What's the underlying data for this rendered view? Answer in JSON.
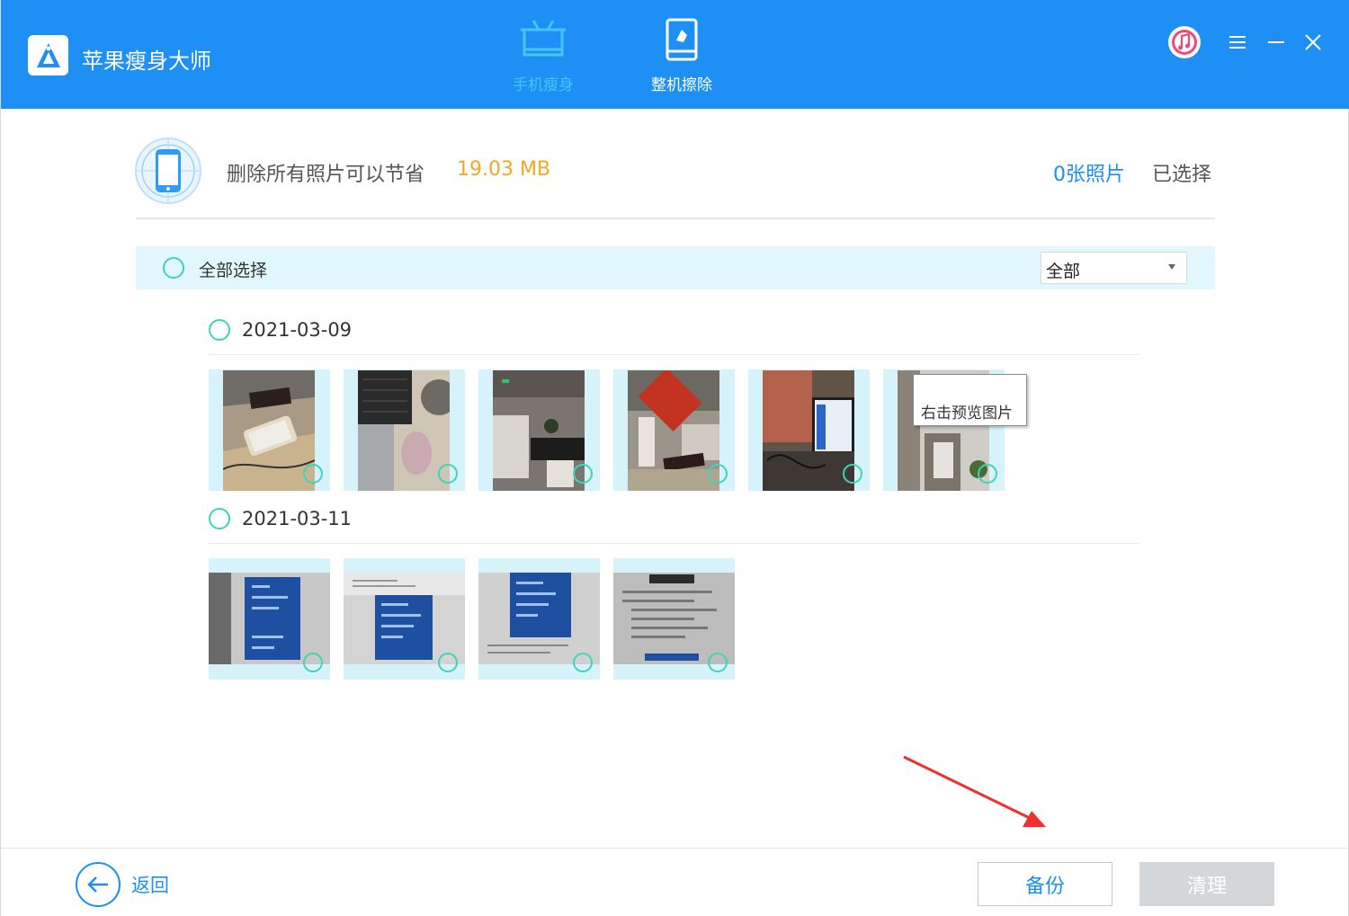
{
  "app": {
    "title": "苹果瘦身大师",
    "accent_color": "#1e90f5",
    "logo_icon": "app-logo-icon"
  },
  "nav": {
    "tabs": [
      {
        "label": "手机瘦身",
        "icon": "broom-tray-icon",
        "active": true
      },
      {
        "label": "整机擦除",
        "icon": "phone-erase-icon",
        "active": false
      }
    ]
  },
  "window_controls": {
    "itunes_icon": "itunes-icon",
    "menu_icon": "menu-icon",
    "minimize_icon": "minimize-icon",
    "close_icon": "close-icon"
  },
  "summary": {
    "text": "删除所有照片可以节省",
    "size": "19.03 MB",
    "size_color": "#f5a623",
    "photo_count": "0张照片",
    "selected_label": "已选择"
  },
  "toolbar": {
    "select_all_label": "全部选择",
    "filter_value": "全部"
  },
  "groups": [
    {
      "date": "2021-03-09",
      "photo_count": 6
    },
    {
      "date": "2021-03-11",
      "photo_count": 4
    }
  ],
  "tooltip": {
    "text": "右击预览图片"
  },
  "footer": {
    "back_label": "返回",
    "backup_label": "备份",
    "clean_label": "清理",
    "clean_enabled": false
  }
}
